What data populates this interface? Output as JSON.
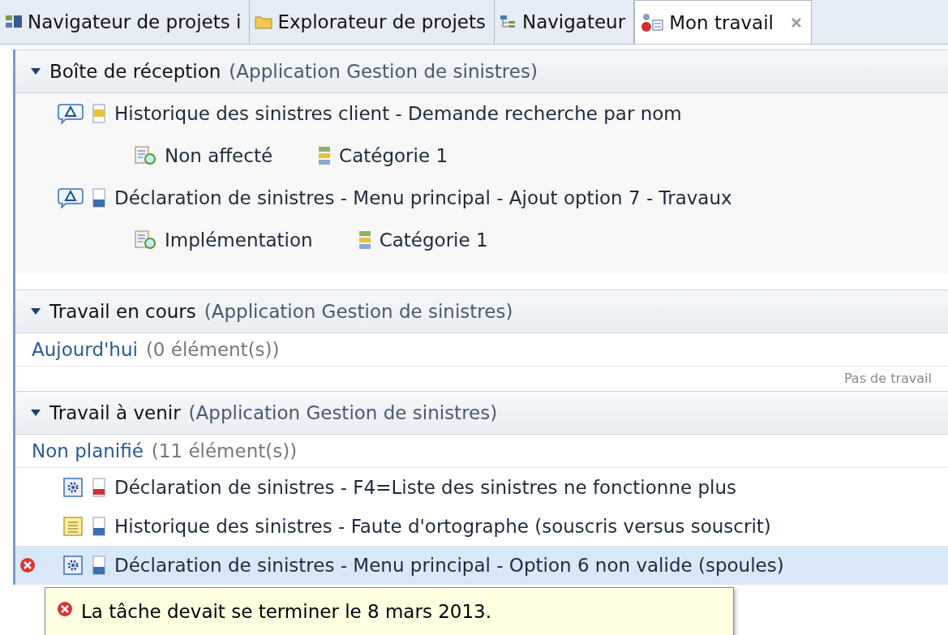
{
  "tabs": [
    {
      "label": "Navigateur de projets i",
      "selected": false
    },
    {
      "label": "Explorateur de projets",
      "selected": false
    },
    {
      "label": "Navigateur",
      "selected": false
    },
    {
      "label": "Mon travail",
      "selected": true,
      "closable": true
    }
  ],
  "sections": [
    {
      "title": "Boîte de réception",
      "context": "(Application Gestion de sinistres)",
      "expanded": true,
      "items": [
        {
          "kind": "incoming",
          "title": "Historique des sinistres client - Demande recherche par nom",
          "color": "#e8c040",
          "status": "Non affecté",
          "category": "Catégorie 1",
          "selected": false
        },
        {
          "kind": "incoming",
          "title": "Déclaration de sinistres - Menu principal - Ajout option 7 - Travaux",
          "color": "#3a6fb0",
          "status": "Implémentation",
          "category": "Catégorie 1",
          "selected": false
        }
      ]
    },
    {
      "title": "Travail en cours",
      "context": "(Application Gestion de sinistres)",
      "expanded": true,
      "groups": [
        {
          "label": "Aujourd'hui",
          "count": "(0 élément(s))",
          "empty_note": "Pas de travail"
        }
      ]
    },
    {
      "title": "Travail à venir",
      "context": "(Application Gestion de sinistres)",
      "expanded": true,
      "groups": [
        {
          "label": "Non planifié",
          "count": "(11 élément(s))",
          "items": [
            {
              "kind": "task",
              "title": "Déclaration de sinistres - F4=Liste des sinistres ne fonctionne plus",
              "color": "#d03030",
              "selected": false,
              "overdue": false
            },
            {
              "kind": "note",
              "title": "Historique des sinistres - Faute d'ortographe (souscris versus souscrit)",
              "color": "#3a6fb0",
              "selected": false,
              "overdue": false
            },
            {
              "kind": "task",
              "title": "Déclaration de sinistres - Menu principal - Option 6 non valide (spoules)",
              "color": "#3a6fb0",
              "selected": true,
              "overdue": true
            }
          ]
        }
      ]
    }
  ],
  "tooltip": {
    "text": "La tâche devait se terminer le 8 mars 2013."
  }
}
